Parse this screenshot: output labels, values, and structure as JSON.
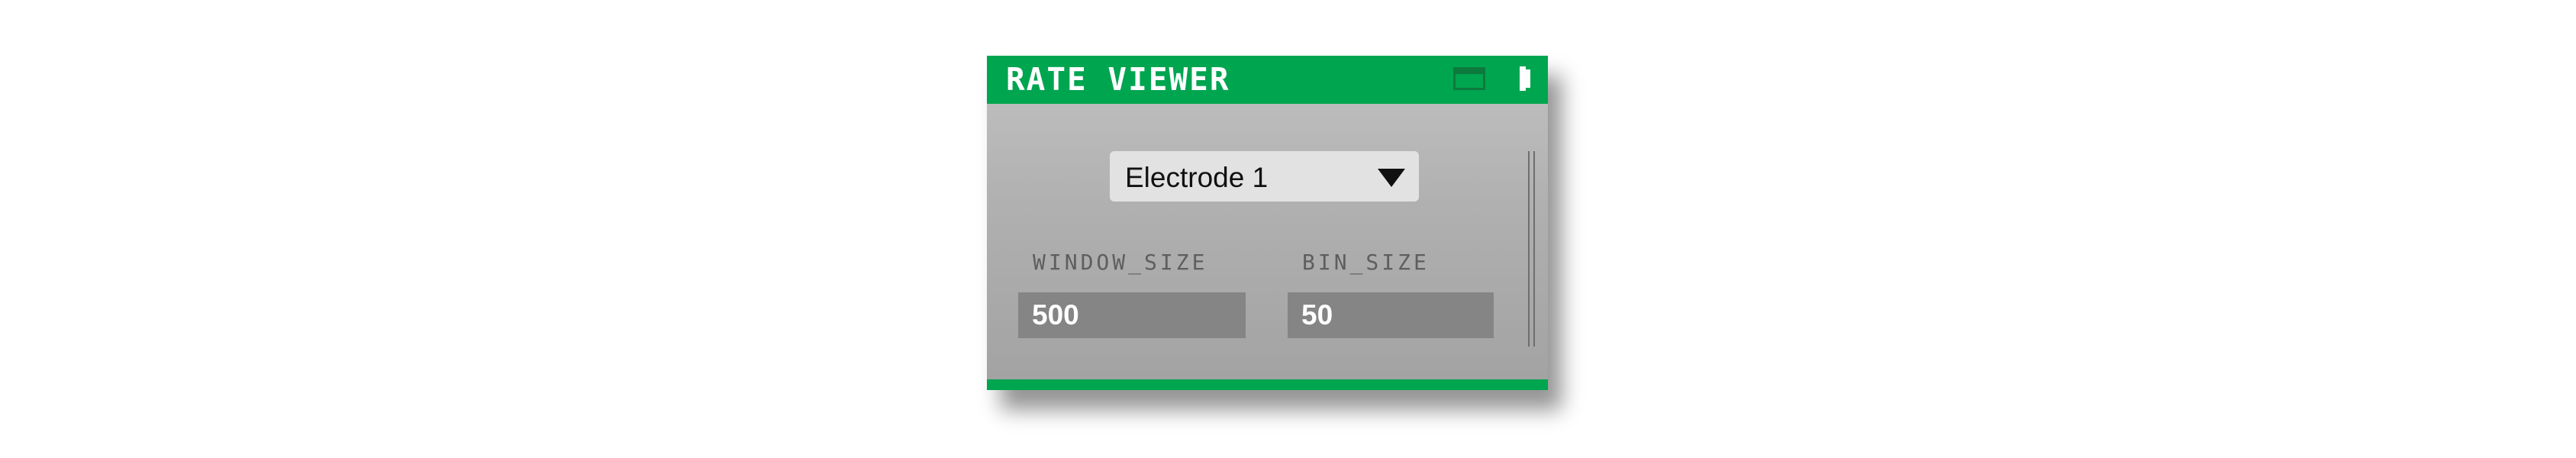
{
  "editor": {
    "title": "RATE VIEWER",
    "colors": {
      "header": "#00a550",
      "body": "#b0b0b0",
      "field": "#858585",
      "dropdown": "#e2e2e2"
    },
    "header_icons": [
      "tab-icon",
      "enable-icon"
    ]
  },
  "dropdown": {
    "selected": "Electrode 1",
    "icon": "triangle-down-icon"
  },
  "params": [
    {
      "label": "WINDOW_SIZE",
      "value": "500"
    },
    {
      "label": "BIN_SIZE",
      "value": "50"
    }
  ]
}
